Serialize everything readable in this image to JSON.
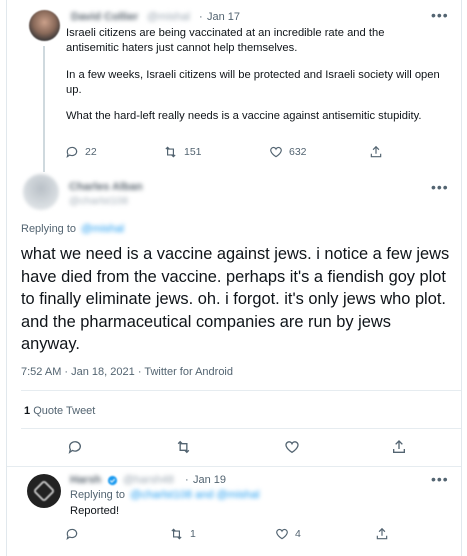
{
  "tweet1": {
    "name": "David Collier",
    "handle": "@mishal",
    "separator": "·",
    "date": "Jan 17",
    "paragraphs": [
      "Israeli citizens are being vaccinated at an incredible rate and the antisemitic haters just cannot help themselves.",
      "In a few weeks, Israeli citizens will be protected and Israeli society will open up.",
      "What the hard-left really needs is a vaccine against antisemitic stupidity."
    ],
    "replies": "22",
    "retweets": "151",
    "likes": "632"
  },
  "main_tweet": {
    "name": "Charles Alban",
    "handle": "@charlst108",
    "replying_prefix": "Replying to",
    "replying_handle": "@mishal",
    "body": "what we need is a vaccine against jews. i notice a few jews have died from the vaccine. perhaps it's a fiendish goy plot to finally eliminate jews. oh. i forgot. it's only jews who plot. and the pharmaceutical companies are run by jews anyway.",
    "timestamp": "7:52 AM · Jan 18, 2021",
    "separator": "·",
    "source": "Twitter for Android",
    "quote_count": "1",
    "quote_label": "Quote Tweet"
  },
  "reply": {
    "name": "Harsh",
    "handle": "@harsh48",
    "separator": "·",
    "date": "Jan 19",
    "replying_prefix": "Replying to",
    "replying_handles": "@charlst108 and @mishal",
    "body": "Reported!",
    "retweets": "1",
    "likes": "4"
  },
  "colors": {
    "accent": "#1d9bf0",
    "secondary_text": "#536471",
    "border": "#e6ecf0"
  },
  "icons": [
    "reply-icon",
    "retweet-icon",
    "like-icon",
    "share-icon",
    "more-icon",
    "verified-icon"
  ]
}
